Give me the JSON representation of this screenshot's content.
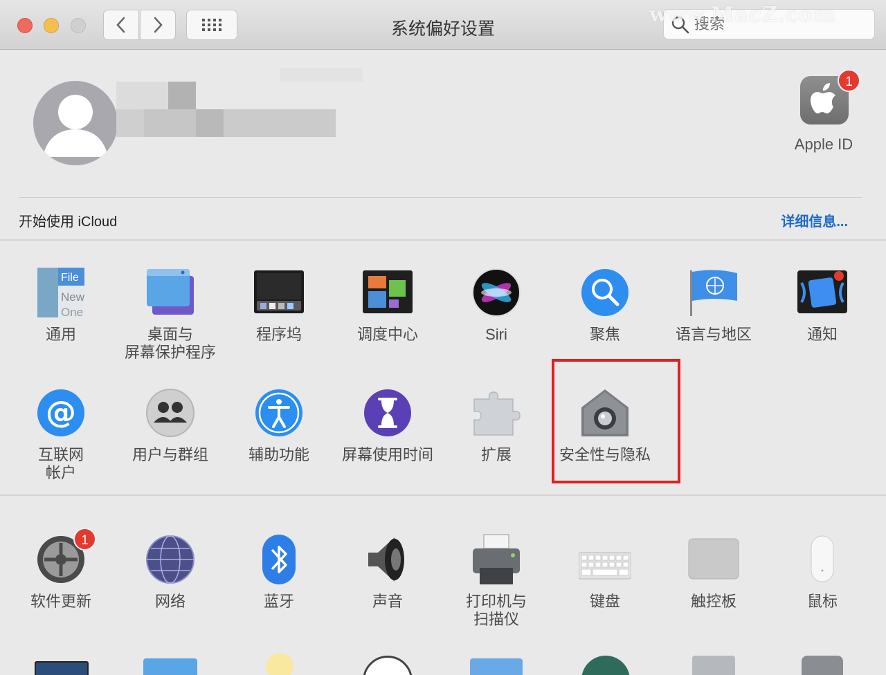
{
  "window": {
    "title": "系统偏好设置",
    "search_placeholder": "搜索",
    "watermark": "www.MacZ.com"
  },
  "account": {
    "apple_id_label": "Apple ID",
    "apple_id_badge": "1",
    "icloud_label": "开始使用 iCloud",
    "icloud_link": "详细信息..."
  },
  "row1": [
    {
      "label": "通用",
      "icon": "general-icon"
    },
    {
      "label": "桌面与\n屏幕保护程序",
      "icon": "desktop-icon"
    },
    {
      "label": "程序坞",
      "icon": "dock-icon"
    },
    {
      "label": "调度中心",
      "icon": "mission-control-icon"
    },
    {
      "label": "Siri",
      "icon": "siri-icon"
    },
    {
      "label": "聚焦",
      "icon": "spotlight-icon"
    },
    {
      "label": "语言与地区",
      "icon": "language-region-icon"
    },
    {
      "label": "通知",
      "icon": "notifications-icon"
    }
  ],
  "row2": [
    {
      "label": "互联网\n帐户",
      "icon": "internet-accounts-icon"
    },
    {
      "label": "用户与群组",
      "icon": "users-groups-icon"
    },
    {
      "label": "辅助功能",
      "icon": "accessibility-icon"
    },
    {
      "label": "屏幕使用时间",
      "icon": "screen-time-icon"
    },
    {
      "label": "扩展",
      "icon": "extensions-icon"
    },
    {
      "label": "安全性与隐私",
      "icon": "security-privacy-icon"
    }
  ],
  "row3": [
    {
      "label": "软件更新",
      "icon": "software-update-icon",
      "badge": "1"
    },
    {
      "label": "网络",
      "icon": "network-icon"
    },
    {
      "label": "蓝牙",
      "icon": "bluetooth-icon"
    },
    {
      "label": "声音",
      "icon": "sound-icon"
    },
    {
      "label": "打印机与\n扫描仪",
      "icon": "printers-scanners-icon"
    },
    {
      "label": "键盘",
      "icon": "keyboard-icon"
    },
    {
      "label": "触控板",
      "icon": "trackpad-icon"
    },
    {
      "label": "鼠标",
      "icon": "mouse-icon"
    }
  ],
  "general_icon_text": {
    "line1": "File",
    "line2": "New",
    "line3": "One"
  },
  "colors": {
    "highlight": "#e0201f",
    "link": "#1b6ac9",
    "badge": "#e4392f"
  }
}
